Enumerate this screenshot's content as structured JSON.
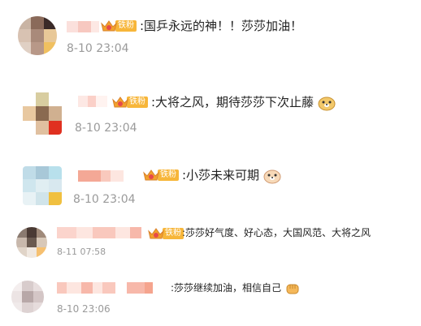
{
  "comments": [
    {
      "badge": "铁粉",
      "text": ":国乒永远的神！！莎莎加油！",
      "time": "8-10 23:04",
      "emoji": ""
    },
    {
      "badge": "铁粉",
      "text": ":大将之风，期待莎莎下次止藤",
      "time": "8-10 23:04",
      "emoji": "doge-face-icon"
    },
    {
      "badge": "铁粉",
      "text": ":小莎未来可期",
      "time": "8-10 23:04",
      "emoji": "doge-face-icon"
    },
    {
      "badge": "铁粉",
      "text": ":莎莎好气度、好心态，大国风范、大将之风",
      "time": "8-11 07:58",
      "emoji": ""
    },
    {
      "badge": "",
      "text": ":莎莎继续加油，相信自己",
      "time": "8-10 23:06",
      "emoji": "fist-icon"
    }
  ],
  "colors": {
    "badge": "#f7b63a",
    "time": "#9a9a9a",
    "text": "#222222"
  }
}
